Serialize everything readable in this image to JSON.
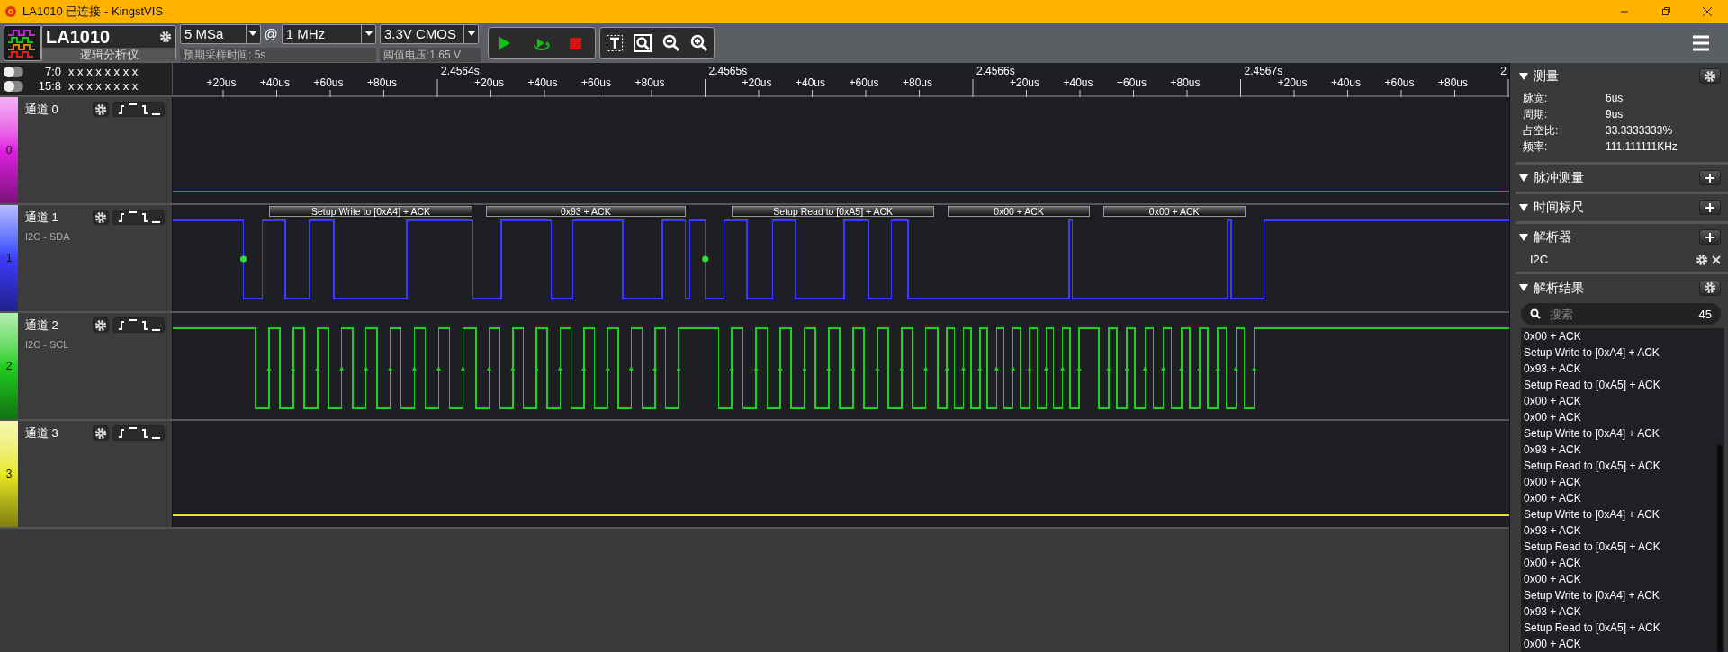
{
  "window": {
    "title": "LA1010 已连接 - KingstVIS"
  },
  "device": {
    "name": "LA1010",
    "subtitle": "逻辑分析仪"
  },
  "sampling": {
    "depth": "5 MSa",
    "at": "@",
    "rate": "1 MHz",
    "caption": "预期采样时间: 5s"
  },
  "threshold": {
    "value": "3.3V CMOS",
    "caption": "阈值电压:1.65 V"
  },
  "bus_status": [
    {
      "label": "7:0",
      "bits": "x x x x x x x x",
      "on": false
    },
    {
      "label": "15:8",
      "bits": "x x x x x x x x",
      "on": false
    }
  ],
  "ruler": {
    "labels": [
      "+20us",
      "+40us",
      "+60us",
      "+80us",
      "2.4564s",
      "+20us",
      "+40us",
      "+60us",
      "+80us",
      "2.4565s",
      "+20us",
      "+40us",
      "+60us",
      "+80us",
      "2.4566s",
      "+20us",
      "+40us",
      "+60us",
      "+80us",
      "2.4567s",
      "+20us",
      "+40us",
      "+60us",
      "+80us",
      "2"
    ]
  },
  "channels": [
    {
      "number": "0",
      "name": "通道 0",
      "color": "#e020e0",
      "kind": "idle"
    },
    {
      "number": "1",
      "name": "通道 1",
      "protocol": "I2C - SDA",
      "color": "#3c3cff",
      "kind": "data",
      "decodes": [
        "Setup Write to [0xA4] + ACK",
        "0x93 + ACK",
        "Setup Read to [0xA5] + ACK",
        "0x00 + ACK",
        "0x00 + ACK"
      ]
    },
    {
      "number": "2",
      "name": "通道 2",
      "protocol": "I2C - SCL",
      "color": "#20d020",
      "kind": "clock"
    },
    {
      "number": "3",
      "name": "通道 3",
      "color": "#e8e820",
      "kind": "idle"
    }
  ],
  "panel": {
    "measure": {
      "title": "测量",
      "expanded": true,
      "rows": [
        {
          "label": "脉宽:",
          "value": "6us"
        },
        {
          "label": "周期:",
          "value": "9us"
        },
        {
          "label": "占空比:",
          "value": "33.3333333%"
        },
        {
          "label": "频率:",
          "value": "111.111111KHz"
        }
      ]
    },
    "pulse": {
      "title": "脉冲测量",
      "expanded": true
    },
    "cursor": {
      "title": "时间标尺",
      "expanded": true
    },
    "decoders": {
      "title": "解析器",
      "expanded": true,
      "items": [
        "I2C"
      ]
    },
    "results": {
      "title": "解析结果",
      "expanded": true,
      "placeholder": "搜索",
      "count": "45",
      "items": [
        "0x00 + ACK",
        "Setup Write to [0xA4] + ACK",
        "0x93 + ACK",
        "Setup Read to [0xA5] + ACK",
        "0x00 + ACK",
        "0x00 + ACK",
        "Setup Write to [0xA4] + ACK",
        "0x93 + ACK",
        "Setup Read to [0xA5] + ACK",
        "0x00 + ACK",
        "0x00 + ACK",
        "Setup Write to [0xA4] + ACK",
        "0x93 + ACK",
        "Setup Read to [0xA5] + ACK",
        "0x00 + ACK",
        "0x00 + ACK",
        "Setup Write to [0xA4] + ACK",
        "0x93 + ACK",
        "Setup Read to [0xA5] + ACK",
        "0x00 + ACK"
      ]
    }
  }
}
